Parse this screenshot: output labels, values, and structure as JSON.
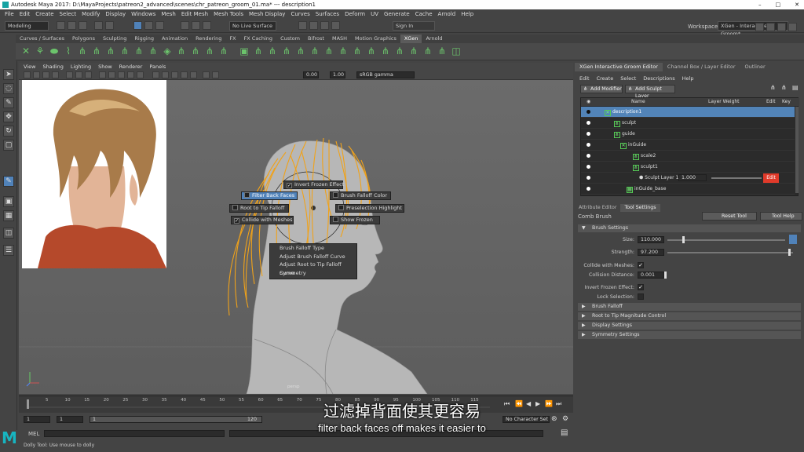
{
  "window": {
    "title": "Autodesk Maya 2017: D:\\MayaProjects\\patreon2_advanced\\scenes\\chr_patreon_groom_01.ma*  ---  description1",
    "controls": [
      "–",
      "□",
      "✕"
    ]
  },
  "menubar": [
    "File",
    "Edit",
    "Create",
    "Select",
    "Modify",
    "Display",
    "Windows",
    "Mesh",
    "Edit Mesh",
    "Mesh Tools",
    "Mesh Display",
    "Curves",
    "Surfaces",
    "Deform",
    "UV",
    "Generate",
    "Cache",
    "Arnold",
    "Help"
  ],
  "statusline": {
    "mode": "Modeling",
    "live_surface": "No Live Surface",
    "sign_in": "Sign In",
    "workspace_label": "Workspace :",
    "workspace_value": "XGen - Interactive Groom*"
  },
  "shelf_tabs": [
    "Curves / Surfaces",
    "Polygons",
    "Sculpting",
    "Rigging",
    "Animation",
    "Rendering",
    "FX",
    "FX Caching",
    "Custom",
    "Bifrost",
    "MASH",
    "Motion Graphics",
    "XGen",
    "Arnold"
  ],
  "shelf_active": "XGen",
  "viewport": {
    "menus": [
      "View",
      "Shading",
      "Lighting",
      "Show",
      "Renderer",
      "Panels"
    ],
    "exposure": "0.00",
    "gamma": "1.00",
    "color_space": "sRGB gamma",
    "camera": "persp"
  },
  "marking_menu": {
    "invert_frozen": "Invert Frozen Effect",
    "filter_back": "Filter Back Faces",
    "brush_falloff_color": "Brush Falloff Color",
    "root_tip": "Root to Tip Falloff",
    "preselection": "Preselection Highlight",
    "collide": "Collide with Meshes",
    "show_frozen": "Show Frozen",
    "submenu": [
      "Brush Falloff Type",
      "Adjust Brush Falloff Curve",
      "Adjust Root to Tip Falloff Curve",
      "Symmetry"
    ]
  },
  "timeline": {
    "ticks": [
      "5",
      "10",
      "15",
      "20",
      "25",
      "30",
      "35",
      "40",
      "45",
      "50",
      "55",
      "60",
      "65",
      "70",
      "75",
      "80",
      "85",
      "90",
      "95",
      "100",
      "105",
      "110",
      "115"
    ],
    "start": "1",
    "start2": "1",
    "slider_start": "1",
    "slider_end": "120",
    "no_character_set": "No Character Set"
  },
  "mel_label": "MEL",
  "help_line": "Dolly Tool: Use mouse to dolly",
  "panel": {
    "tabs": [
      "XGen Interactive Groom Editor",
      "Channel Box / Layer Editor",
      "Outliner"
    ],
    "menus": [
      "Edit",
      "Create",
      "Select",
      "Descriptions",
      "Help"
    ],
    "add_modifier": "Add Modifier",
    "add_sculpt_layer": "Add Sculpt Layer",
    "columns": [
      "Name",
      "Layer Weight",
      "Edit",
      "Key"
    ],
    "rows": [
      {
        "name": "description1",
        "selected": true
      },
      {
        "name": "sculpt"
      },
      {
        "name": "guide"
      },
      {
        "name": "inGuide"
      },
      {
        "name": "scale2"
      },
      {
        "name": "sculpt1"
      },
      {
        "name": "Sculpt Layer 1",
        "weight": "1.000"
      },
      {
        "name": "inGuide_base"
      }
    ],
    "edit_button": "Edit"
  },
  "attr": {
    "tabs": [
      "Attribute Editor",
      "Tool Settings"
    ],
    "tool_name": "Comb Brush",
    "reset_tool": "Reset Tool",
    "tool_help": "Tool Help",
    "brush_settings": "Brush Settings",
    "size_label": "Size:",
    "size": "110.000",
    "size_level": 0.13,
    "strength_label": "Strength:",
    "strength": "97.200",
    "strength_level": 0.97,
    "collide_label": "Collide with Meshes:",
    "collision_label": "Collision Distance:",
    "collision": "0.001",
    "invert_label": "Invert Frozen Effect:",
    "lock_label": "Lock Selection:",
    "sections": [
      "Brush Falloff",
      "Root to Tip Magnitude Control",
      "Display Settings",
      "Symmetry Settings"
    ]
  },
  "subtitle": {
    "zh": "过滤掉背面使其更容易",
    "en": "filter back faces off makes it easier to"
  }
}
